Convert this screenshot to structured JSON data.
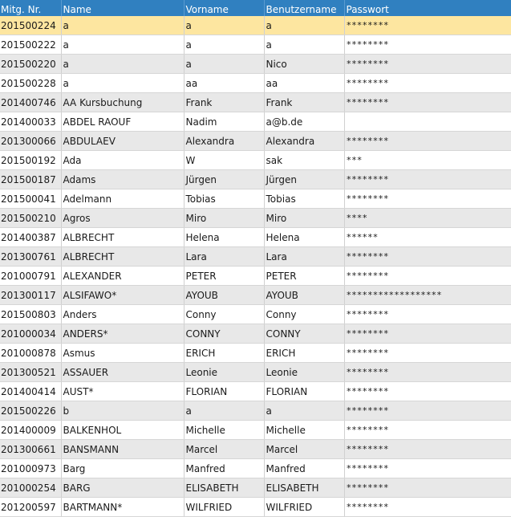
{
  "columns": [
    "Mitg. Nr.",
    "Name",
    "Vorname",
    "Benutzername",
    "Passwort"
  ],
  "selected_index": 0,
  "rows": [
    [
      "201500224",
      "a",
      "a",
      "a",
      "********"
    ],
    [
      "201500222",
      "a",
      "a",
      "a",
      "********"
    ],
    [
      "201500220",
      "a",
      "a",
      "Nico",
      "********"
    ],
    [
      "201500228",
      "a",
      "aa",
      "aa",
      "********"
    ],
    [
      "201400746",
      "AA Kursbuchung",
      "Frank",
      "Frank",
      "********"
    ],
    [
      "201400033",
      "ABDEL RAOUF",
      "Nadim",
      "a@b.de",
      ""
    ],
    [
      "201300066",
      "ABDULAEV",
      "Alexandra",
      "Alexandra",
      "********"
    ],
    [
      "201500192",
      "Ada",
      "W",
      "sak",
      "***"
    ],
    [
      "201500187",
      "Adams",
      "Jürgen",
      "Jürgen",
      "********"
    ],
    [
      "201500041",
      "Adelmann",
      "Tobias",
      "Tobias",
      "********"
    ],
    [
      "201500210",
      "Agros",
      "Miro",
      "Miro",
      "****"
    ],
    [
      "201400387",
      "ALBRECHT",
      "Helena",
      "Helena",
      "******"
    ],
    [
      "201300761",
      "ALBRECHT",
      "Lara",
      "Lara",
      "********"
    ],
    [
      "201000791",
      "ALEXANDER",
      "PETER",
      "PETER",
      "********"
    ],
    [
      "201300117",
      "ALSIFAWO*",
      "AYOUB",
      "AYOUB",
      "******************"
    ],
    [
      "201500803",
      "Anders",
      "Conny",
      "Conny",
      "********"
    ],
    [
      "201000034",
      "ANDERS*",
      "CONNY",
      "CONNY",
      "********"
    ],
    [
      "201000878",
      "Asmus",
      "ERICH",
      "ERICH",
      "********"
    ],
    [
      "201300521",
      "ASSAUER",
      "Leonie",
      "Leonie",
      "********"
    ],
    [
      "201400414",
      "AUST*",
      "FLORIAN",
      "FLORIAN",
      "********"
    ],
    [
      "201500226",
      "b",
      "a",
      "a",
      "********"
    ],
    [
      "201400009",
      "BALKENHOL",
      "Michelle",
      "Michelle",
      "********"
    ],
    [
      "201300661",
      "BANSMANN",
      "Marcel",
      "Marcel",
      "********"
    ],
    [
      "201000973",
      "Barg",
      "Manfred",
      "Manfred",
      "********"
    ],
    [
      "201000254",
      "BARG",
      "ELISABETH",
      "ELISABETH",
      "********"
    ],
    [
      "201200597",
      "BARTMANN*",
      "WILFRIED",
      "WILFRIED",
      "********"
    ]
  ]
}
